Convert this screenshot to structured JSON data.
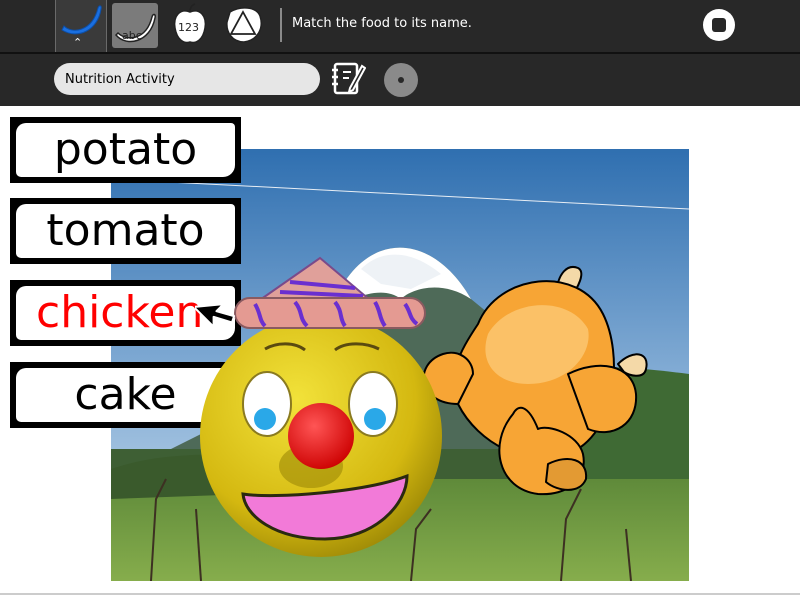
{
  "toolbar": {
    "tabs": [
      {
        "icon": "banana-icon",
        "active": true
      },
      {
        "icon": "abc-icon",
        "label": "abc"
      },
      {
        "icon": "apple-123-icon",
        "label": "123"
      },
      {
        "icon": "triangle-icon"
      }
    ],
    "instruction": "Match the food to its name.",
    "stop_icon": "stop-icon"
  },
  "activity_bar": {
    "title_value": "Nutrition Activity",
    "journal_icon": "journal-icon",
    "share_icon": "share-icon"
  },
  "cards": [
    {
      "label": "potato",
      "color": "#000000"
    },
    {
      "label": "tomato",
      "color": "#000000"
    },
    {
      "label": "chicken",
      "color": "#ff0000"
    },
    {
      "label": "cake",
      "color": "#000000"
    }
  ],
  "colors": {
    "toolbar_bg": "#282828",
    "active_tab_blue": "#1a6fe0",
    "highlight_red": "#ff0000"
  }
}
